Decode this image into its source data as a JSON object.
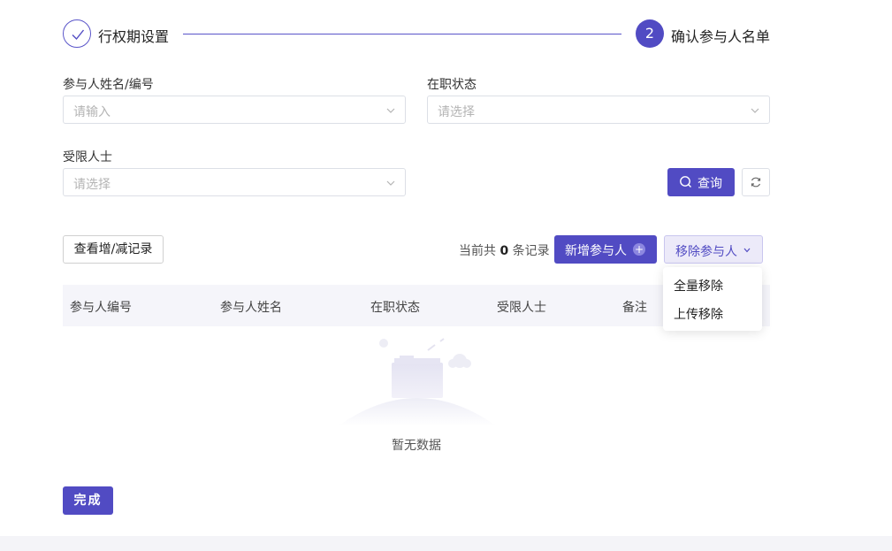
{
  "steps": [
    {
      "label": "行权期设置",
      "state": "done"
    },
    {
      "number": "2",
      "label": "确认参与人名单",
      "state": "active"
    }
  ],
  "filters": {
    "participant": {
      "label": "参与人姓名/编号",
      "placeholder": "请输入"
    },
    "employment_status": {
      "label": "在职状态",
      "placeholder": "请选择"
    },
    "restricted": {
      "label": "受限人士",
      "placeholder": "请选择"
    },
    "query_label": "查询"
  },
  "toolbar": {
    "view_log_label": "查看增/减记录",
    "count_prefix": "当前共",
    "count_value": "0",
    "count_suffix": "条记录",
    "add_label": "新增参与人",
    "remove_label": "移除参与人"
  },
  "table": {
    "columns": [
      "参与人编号",
      "参与人姓名",
      "在职状态",
      "受限人士",
      "备注"
    ],
    "rows": []
  },
  "remove_menu": {
    "items": [
      "全量移除",
      "上传移除"
    ]
  },
  "empty_text": "暂无数据",
  "done_label": "完成",
  "colors": {
    "primary": "#514bc3",
    "header_bg": "#f5f5fa",
    "border": "#dcdfe6"
  }
}
